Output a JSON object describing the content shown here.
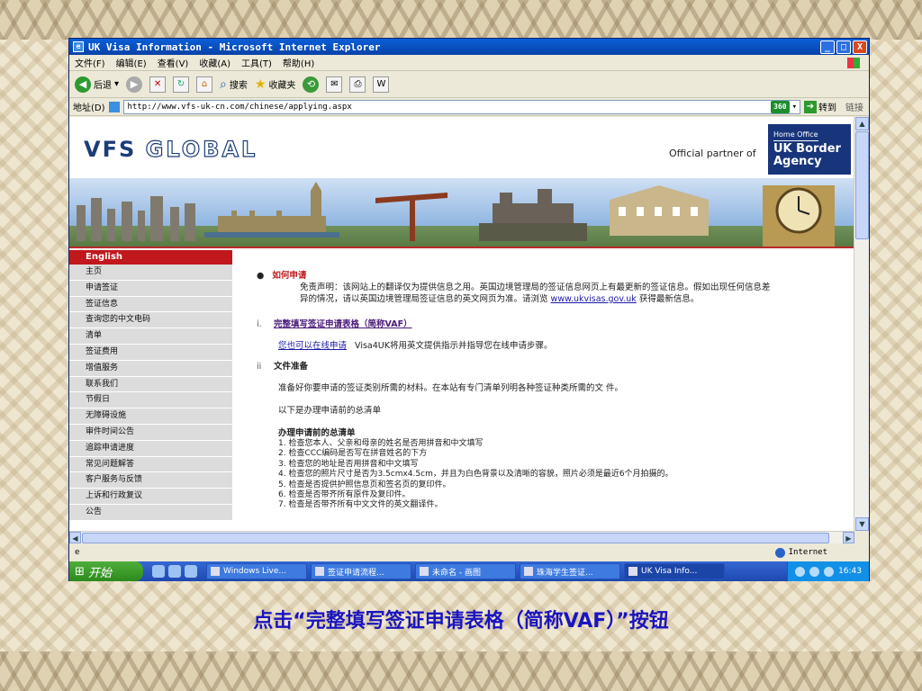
{
  "window": {
    "title": "UK Visa Information - Microsoft Internet Explorer",
    "buttons": {
      "minimize": "_",
      "maximize": "□",
      "close": "X"
    }
  },
  "menu": [
    "文件(F)",
    "编辑(E)",
    "查看(V)",
    "收藏(A)",
    "工具(T)",
    "帮助(H)"
  ],
  "toolbar": {
    "back": "后退",
    "search": "搜索",
    "favorites": "收藏夹"
  },
  "address": {
    "label": "地址(D)",
    "url": "http://www.vfs-uk-cn.com/chinese/applying.aspx",
    "badge": "360",
    "go": "转到",
    "links": "链接"
  },
  "header": {
    "logo_left": "VFS",
    "logo_right": "GLOBAL",
    "partner": "Official partner of",
    "ukba_small": "Home Office",
    "ukba_line1": "UK Border",
    "ukba_line2": "Agency"
  },
  "sidebar": {
    "header": "English",
    "items": [
      "主页",
      "申请签证",
      "签证信息",
      "查询您的中文电码",
      "清单",
      "签证费用",
      "增值服务",
      "联系我们",
      "节假日",
      "无障碍设施",
      "审件时间公告",
      "追踪申请进度",
      "常见问题解答",
      "客户服务与反馈",
      "上诉和行政复议",
      "公告"
    ]
  },
  "content": {
    "title": "如何申请",
    "disclaimer_line1": "免责声明：该网站上的翻译仅为提供信息之用。英国边境管理局的签证信息网页上有最更新的签证信息。假如出现任何信息差",
    "disclaimer_line2_pre": "异的情况，请以英国边境管理局签证信息的英文网页为准。请浏览",
    "disclaimer_link": "www.ukvisas.gov.uk",
    "disclaimer_line2_post": "获得最新信息。",
    "step1_num": "i.",
    "step1_title": "完整填写签证申请表格（简称VAF）",
    "online_link": "您也可以在线申请",
    "online_text": "Visa4UK将用英文提供指示并指导您在线申请步骤。",
    "step2_num": "ii",
    "step2_title": "文件准备",
    "prep_text": "准备好你要申请的签证类别所需的材料。在本站有专门清单列明各种签证种类所需的文 件。",
    "list_intro": "以下是办理申请前的总清单",
    "checklist_title": "办理申请前的总清单",
    "checklist": [
      "1. 检查您本人、父亲和母亲的姓名是否用拼音和中文填写",
      "2. 检查CCC编码是否写在拼音姓名的下方",
      "3. 检查您的地址是否用拼音和中文填写",
      "4. 检查您的照片尺寸是否为3.5cmx4.5cm，并且为白色背景以及清晰的容貌，照片必须是最近6个月拍摄的。",
      "5. 检查是否提供护照信息页和签名页的复印件。",
      "6. 检查是否带齐所有原件及复印件。",
      "7. 检查是否带齐所有中文文件的英文翻译件。"
    ]
  },
  "status": {
    "zone": "Internet"
  },
  "taskbar": {
    "start": "开始",
    "tasks": [
      "Windows Live...",
      "签证申请流程...",
      "未命名 - 画图",
      "珠海学生签证...",
      "UK Visa Info..."
    ],
    "time": "16:43"
  },
  "caption": "点击“完整填写签证申请表格（简称VAF）”按钮"
}
